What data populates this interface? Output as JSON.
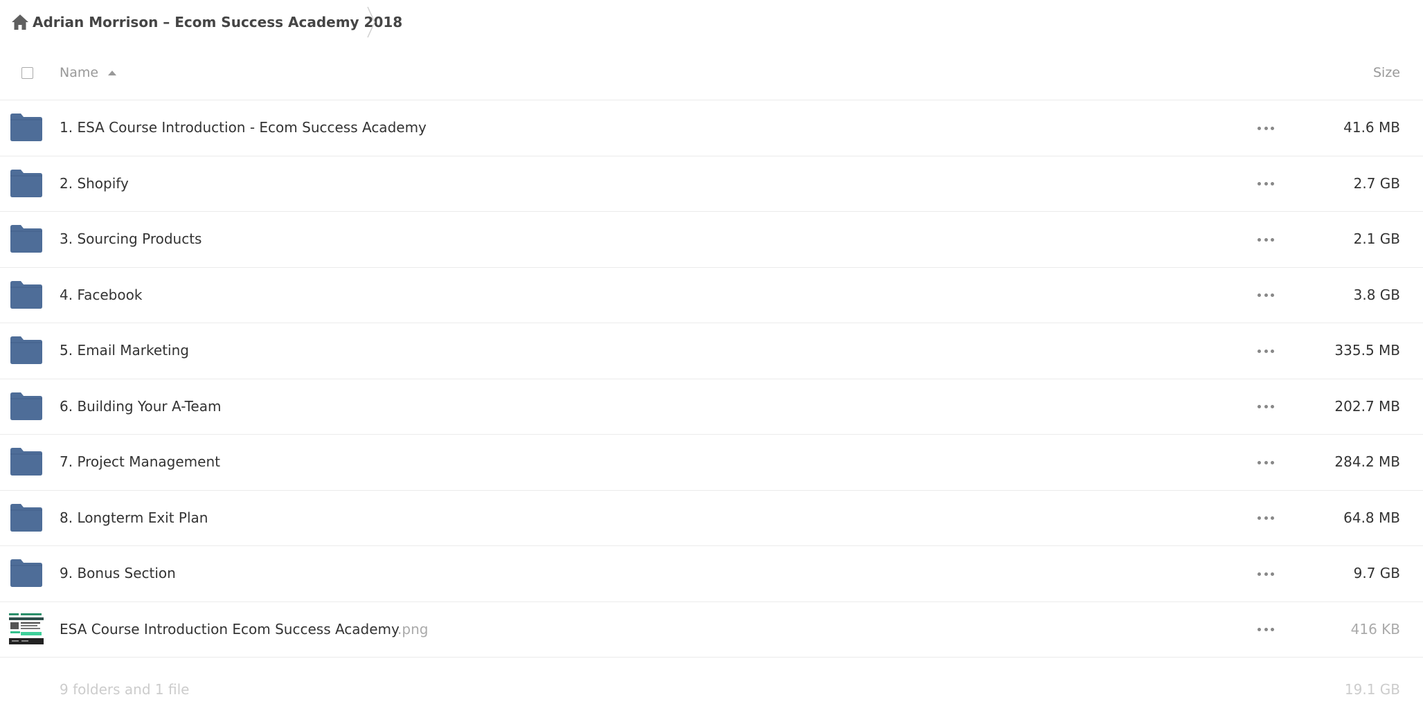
{
  "breadcrumb": {
    "home_icon": "home-icon",
    "title": "Adrian Morrison – Ecom Success Academy 2018"
  },
  "header": {
    "name_label": "Name",
    "size_label": "Size",
    "sort_direction": "ascending"
  },
  "files": [
    {
      "name": "1. ESA Course Introduction - Ecom Success Academy",
      "ext": "",
      "size": "41.6 MB",
      "type": "folder"
    },
    {
      "name": "2. Shopify",
      "ext": "",
      "size": "2.7 GB",
      "type": "folder"
    },
    {
      "name": "3. Sourcing Products",
      "ext": "",
      "size": "2.1 GB",
      "type": "folder"
    },
    {
      "name": "4. Facebook",
      "ext": "",
      "size": "3.8 GB",
      "type": "folder"
    },
    {
      "name": "5. Email Marketing",
      "ext": "",
      "size": "335.5 MB",
      "type": "folder"
    },
    {
      "name": "6. Building Your A-Team",
      "ext": "",
      "size": "202.7 MB",
      "type": "folder"
    },
    {
      "name": "7. Project Management",
      "ext": "",
      "size": "284.2 MB",
      "type": "folder"
    },
    {
      "name": "8. Longterm Exit Plan",
      "ext": "",
      "size": "64.8 MB",
      "type": "folder"
    },
    {
      "name": "9. Bonus Section",
      "ext": "",
      "size": "9.7 GB",
      "type": "folder"
    },
    {
      "name": "ESA Course Introduction Ecom Success Academy",
      "ext": ".png",
      "size": "416 KB",
      "type": "image"
    }
  ],
  "summary": {
    "counts": "9 folders and 1 file",
    "total_size": "19.1 GB"
  },
  "colors": {
    "folder": "#4e6d98",
    "separator": "#ebebeb",
    "muted_text": "#aaaaaa"
  }
}
